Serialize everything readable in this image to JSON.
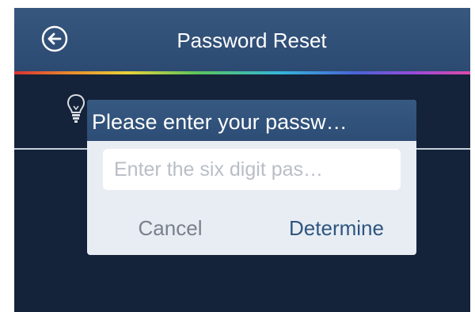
{
  "header": {
    "title": "Password Reset",
    "back_icon": "arrow-left-circle-icon"
  },
  "hint_icon": "lightbulb-icon",
  "dialog": {
    "title": "Please enter your passw…",
    "input": {
      "placeholder": "Enter the six digit pas…",
      "value": ""
    },
    "cancel_label": "Cancel",
    "confirm_label": "Determine"
  },
  "colors": {
    "header_bg": "#2f4f78",
    "screen_bg": "#142339",
    "dialog_bg": "#e8edf4",
    "confirm_text": "#2f5580",
    "cancel_text": "#7a808a"
  }
}
